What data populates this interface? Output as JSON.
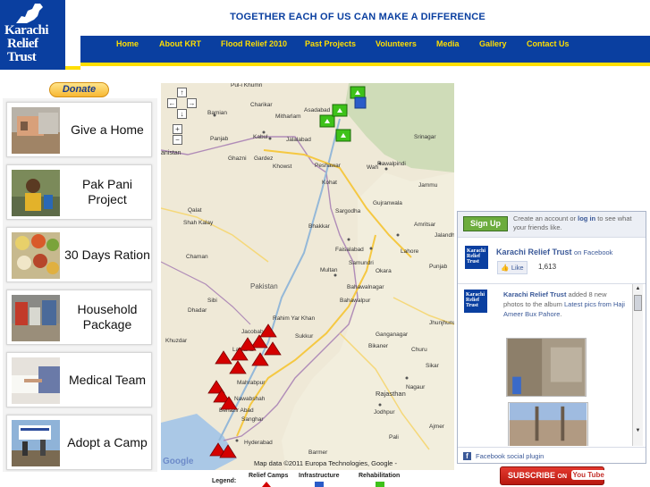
{
  "brand": {
    "line1": "Karachi",
    "line2": "Relief",
    "line3": "Trust"
  },
  "tagline": "TOGETHER EACH OF US CAN MAKE A DIFFERENCE",
  "nav": [
    "Home",
    "About KRT",
    "Flood Relief 2010",
    "Past Projects",
    "Volunteers",
    "Media",
    "Gallery",
    "Contact Us"
  ],
  "donate_label": "Donate",
  "projects": [
    {
      "label": "Give a Home",
      "icon": "house-photo"
    },
    {
      "label": "Pak Pani Project",
      "icon": "child-water-photo"
    },
    {
      "label": "30 Days Ration",
      "icon": "ration-bowls-photo"
    },
    {
      "label": "Household Package",
      "icon": "household-goods-photo"
    },
    {
      "label": "Medical Team",
      "icon": "medical-writing-photo"
    },
    {
      "label": "Adopt a Camp",
      "icon": "camp-banner-photo"
    }
  ],
  "map": {
    "cities": [
      "Pul-i Khumri",
      "Charikar",
      "Asadabad",
      "Mitharlam",
      "Bamian",
      "Kabul",
      "Jalalabad",
      "Panjab",
      "Peshawar",
      "Wah",
      "Rawalpindi",
      "Srinagar",
      "Ghazni",
      "Gardez",
      "Khowst",
      "Kohat",
      "Jammu",
      "Gujranwala",
      "Qalat",
      "Shah Kalay",
      "Bhakkar",
      "Faisalabad",
      "Amritsar",
      "Jalandhar",
      "Lahore",
      "Chaman",
      "Sargodha",
      "Samundri",
      "Okara",
      "Punjab",
      "Pakistan",
      "Multan",
      "Sibi",
      "Bahawalnagar",
      "Dhadar",
      "Bahawalpur",
      "Rahim Yar Khan",
      "Jacobabad",
      "Khuzdar",
      "Sukkur",
      "Larkana",
      "Bikaner",
      "Ganganagar",
      "Churu",
      "Mahrabpur",
      "Nawabshah",
      "Benazir Abad",
      "Sanghar",
      "Jodhpur",
      "Rajasthan",
      "Hyderabad",
      "Pali",
      "Jhunjhunun",
      "Sikar",
      "Barmer",
      "Nagaur",
      "Ajmer"
    ],
    "credit": "Map data ©2011 Europa Technologies, Google -",
    "google": "Google",
    "relief_camps": 13,
    "infrastructure": 5,
    "rehabilitation": 1
  },
  "legend": {
    "title": "Legend:",
    "relief_camps": "Relief Camps",
    "infrastructure": "Infrastructure",
    "rehabilitation": "Rehabilitation"
  },
  "facebook": {
    "signup": "Sign Up",
    "invite_pre": "Create an account or",
    "invite_login": "log in",
    "invite_post": "to see what your friends like.",
    "page_name": "Karachi Relief Trust",
    "on_facebook": "on Facebook",
    "like": "Like",
    "like_count": "1,613",
    "post_author": "Karachi Relief Trust",
    "post_text1": "added 8 new photos to the album",
    "post_link": "Latest pics from Haji Ameer Bux Pahore",
    "post_text2": ".",
    "footer": "Facebook social plugin",
    "logo_text": "Karachi Relief Trust"
  },
  "youtube": {
    "subscribe": "SUBSCRIBE",
    "on": "ON",
    "logo": "You Tube"
  },
  "colors": {
    "brand_blue": "#0a3fa0",
    "nav_yellow": "#ffde00",
    "camp_red": "#cc0000",
    "infra_green": "#3ec21a",
    "fb_blue": "#3b5998"
  }
}
